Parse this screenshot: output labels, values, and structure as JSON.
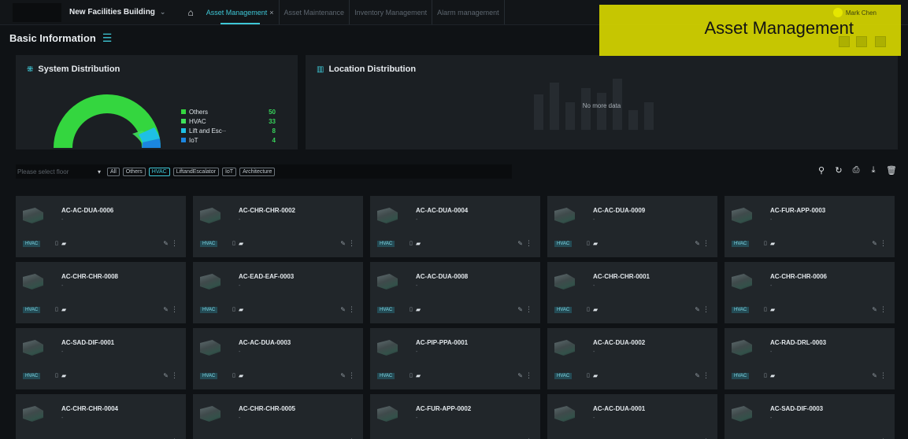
{
  "topbar": {
    "building": "New Facilities Building",
    "tabs": [
      {
        "label": "Asset Management",
        "active": true,
        "closable": true
      },
      {
        "label": "Asset Maintenance",
        "active": false
      },
      {
        "label": "Inventory Management",
        "active": false
      },
      {
        "label": "Alarm management",
        "active": false
      }
    ],
    "user_name": "Mark Chen"
  },
  "highlight": {
    "label": "Asset Management",
    "color": "#d4d400"
  },
  "basic_info": {
    "title": "Basic Information"
  },
  "system_panel": {
    "title": "System Distribution",
    "legend": [
      {
        "label": "Others",
        "value": "50",
        "color": "#34d63f"
      },
      {
        "label": "HVAC",
        "value": "33",
        "color": "#3fe05a"
      },
      {
        "label": "Lift and Esc··",
        "value": "8",
        "color": "#1ec0e4"
      },
      {
        "label": "IoT",
        "value": "4",
        "color": "#1b86e0"
      }
    ]
  },
  "location_panel": {
    "title": "Location Distribution",
    "empty_text": "No more data"
  },
  "filter": {
    "placeholder": "Please select floor",
    "chips": [
      "All",
      "Others",
      "HVAC",
      "LiftandEscalator",
      "IoT",
      "Architecture"
    ],
    "selected_chip": "HVAC"
  },
  "tools": [
    "search-icon",
    "refresh-icon",
    "export-icon",
    "download-icon",
    "delete-icon"
  ],
  "cards": [
    "AC-AC-DUA-0006",
    "AC-CHR-CHR-0002",
    "AC-AC-DUA-0004",
    "AC-AC-DUA-0009",
    "AC-FUR-APP-0003",
    "AC-CHR-CHR-0008",
    "AC-EAD-EAF-0003",
    "AC-AC-DUA-0008",
    "AC-CHR-CHR-0001",
    "AC-CHR-CHR-0006",
    "AC-SAD-DIF-0001",
    "AC-AC-DUA-0003",
    "AC-PIP-PPA-0001",
    "AC-AC-DUA-0002",
    "AC-RAD-DRL-0003",
    "AC-CHR-CHR-0004",
    "AC-CHR-CHR-0005",
    "AC-FUR-APP-0002",
    "AC-AC-DUA-0001",
    "AC-SAD-DIF-0003"
  ],
  "card_tag": "HVAC",
  "card_sub": "-"
}
